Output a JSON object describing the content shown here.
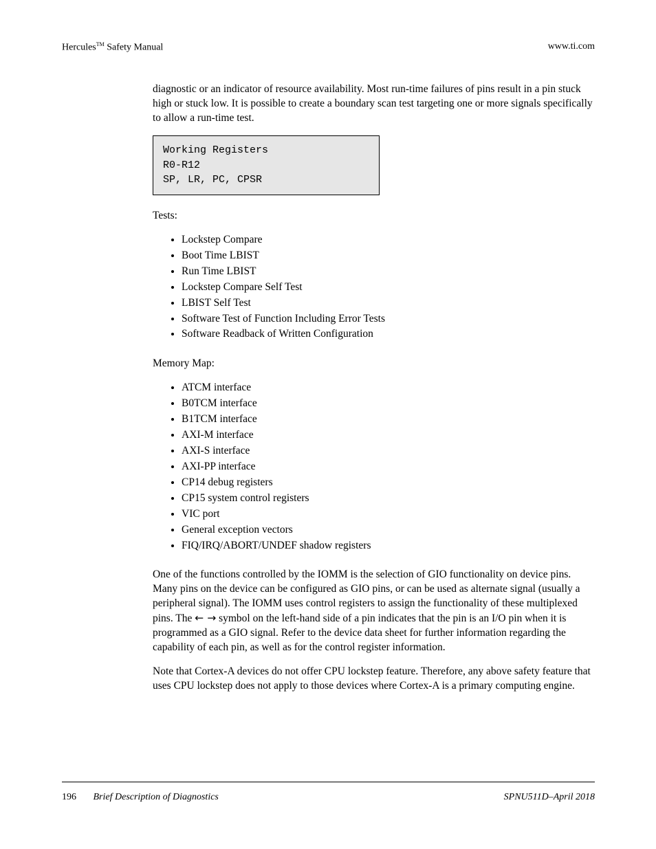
{
  "header": {
    "left_product": "Hercules",
    "left_tm": "TM",
    "left_tail": " Safety Manual",
    "right": "www.ti.com"
  },
  "intro": "diagnostic or an indicator of resource availability. Most run-time failures of pins result in a pin stuck high or stuck low. It is possible to create a boundary scan test targeting one or more signals specifically to allow a run-time test.",
  "code_box": {
    "heading": "Working Registers",
    "lines": [
      "R0-R12",
      "SP, LR, PC, CPSR"
    ]
  },
  "list1": {
    "lead": "Tests:",
    "items": [
      "Lockstep Compare",
      "Boot Time LBIST",
      "Run Time LBIST",
      "Lockstep Compare Self Test",
      "LBIST Self Test",
      "Software Test of Function Including Error Tests",
      "Software Readback of Written Configuration"
    ]
  },
  "list2": {
    "lead": "Memory Map:",
    "items": [
      "ATCM interface",
      "B0TCM interface",
      "B1TCM interface",
      "AXI-M interface",
      "AXI-S interface",
      "AXI-PP interface",
      "CP14 debug registers",
      "CP15 system control registers",
      "VIC port",
      "General exception vectors",
      "FIQ/IRQ/ABORT/UNDEF shadow registers"
    ]
  },
  "mux_paragraph": {
    "pre": "One of the functions controlled by the IOMM is the selection of GIO functionality on device pins. Many pins on the device can be configured as GIO pins, or can be used as alternate signal (usually a peripheral signal). The IOMM uses control registers to assign the functionality of these multiplexed pins. The ",
    "arrows": "←       →",
    "post": " symbol on the left-hand side of a pin indicates that the pin is an I/O pin when it is programmed as a GIO signal. Refer to the device data sheet for further information regarding the capability of each pin, as well as for the control register information."
  },
  "trailing": "Note that Cortex-A devices do not offer CPU lockstep feature. Therefore, any above safety feature that uses CPU lockstep does not apply to those devices where Cortex-A is a primary computing engine.",
  "footer": {
    "left_page": "196",
    "left_text": "Brief Description of Diagnostics",
    "right": "SPNU511D–April 2018"
  }
}
